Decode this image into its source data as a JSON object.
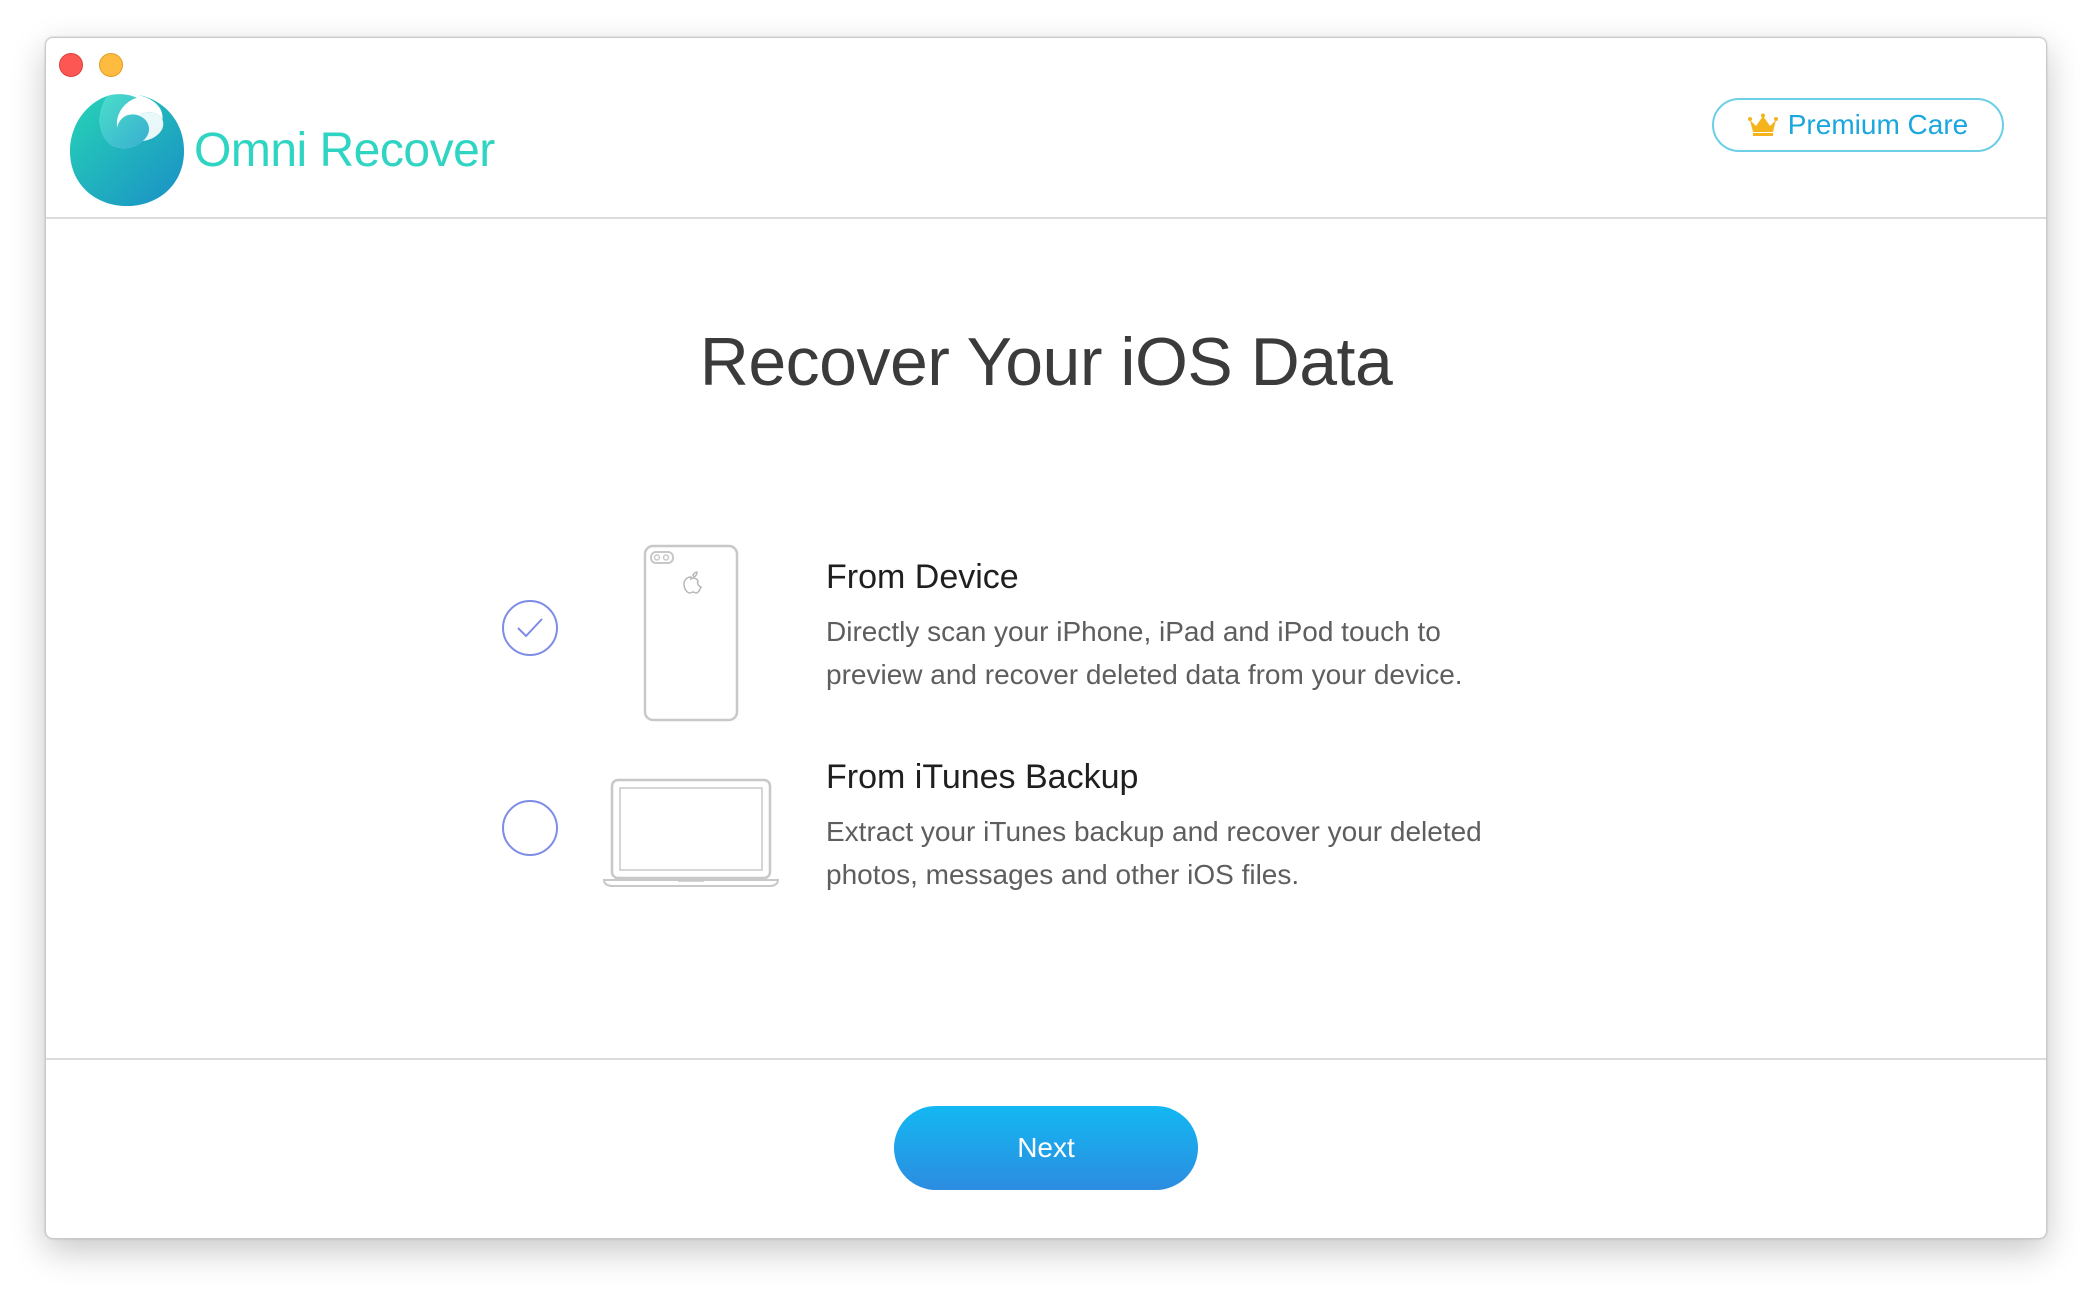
{
  "app": {
    "name": "Omni Recover",
    "brand_color": "#2fd5c2"
  },
  "header": {
    "premium_label": "Premium Care",
    "premium_icon": "crown-icon"
  },
  "main": {
    "title": "Recover Your iOS Data",
    "options": [
      {
        "title": "From Device",
        "description_line1": "Directly scan your iPhone, iPad and iPod touch to",
        "description_line2": "preview and recover deleted data from your device.",
        "icon": "iphone-icon",
        "selected": true
      },
      {
        "title": "From iTunes Backup",
        "description_line1": "Extract your iTunes backup and recover your deleted",
        "description_line2": "photos, messages and other iOS files.",
        "icon": "laptop-icon",
        "selected": false
      }
    ]
  },
  "footer": {
    "next_label": "Next"
  },
  "colors": {
    "accent": "#1aa7dd",
    "radio": "#7d8ce6",
    "next_gradient_top": "#13b8f2",
    "next_gradient_bottom": "#2c8ce0"
  }
}
